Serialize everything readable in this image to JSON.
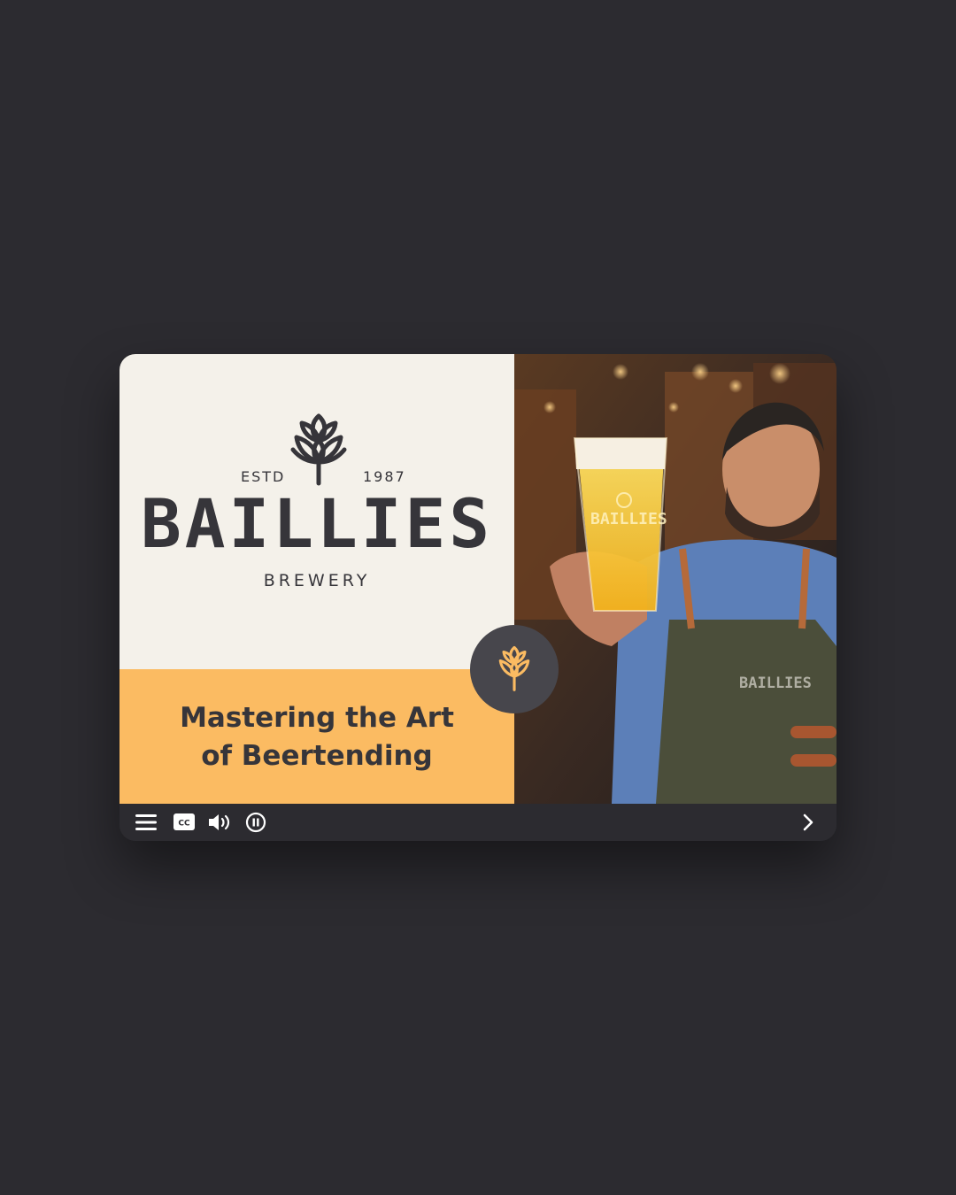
{
  "brand": {
    "estd": "ESTD",
    "year": "1987",
    "name": "BAILLIES",
    "sub": "BREWERY"
  },
  "slide": {
    "title_line1": "Mastering the Art",
    "title_line2": "of Beertending"
  },
  "photo": {
    "glass_text": "BAILLIES",
    "apron_text": "BAILLIES"
  },
  "controls": {
    "menu": "menu-icon",
    "captions": "cc-icon",
    "volume": "volume-icon",
    "pause": "pause-icon",
    "next": "chevron-right-icon"
  },
  "colors": {
    "background": "#2c2b30",
    "cream": "#f4f1ea",
    "accent": "#fbbb62",
    "text": "#36353a",
    "badge": "#47464c"
  }
}
